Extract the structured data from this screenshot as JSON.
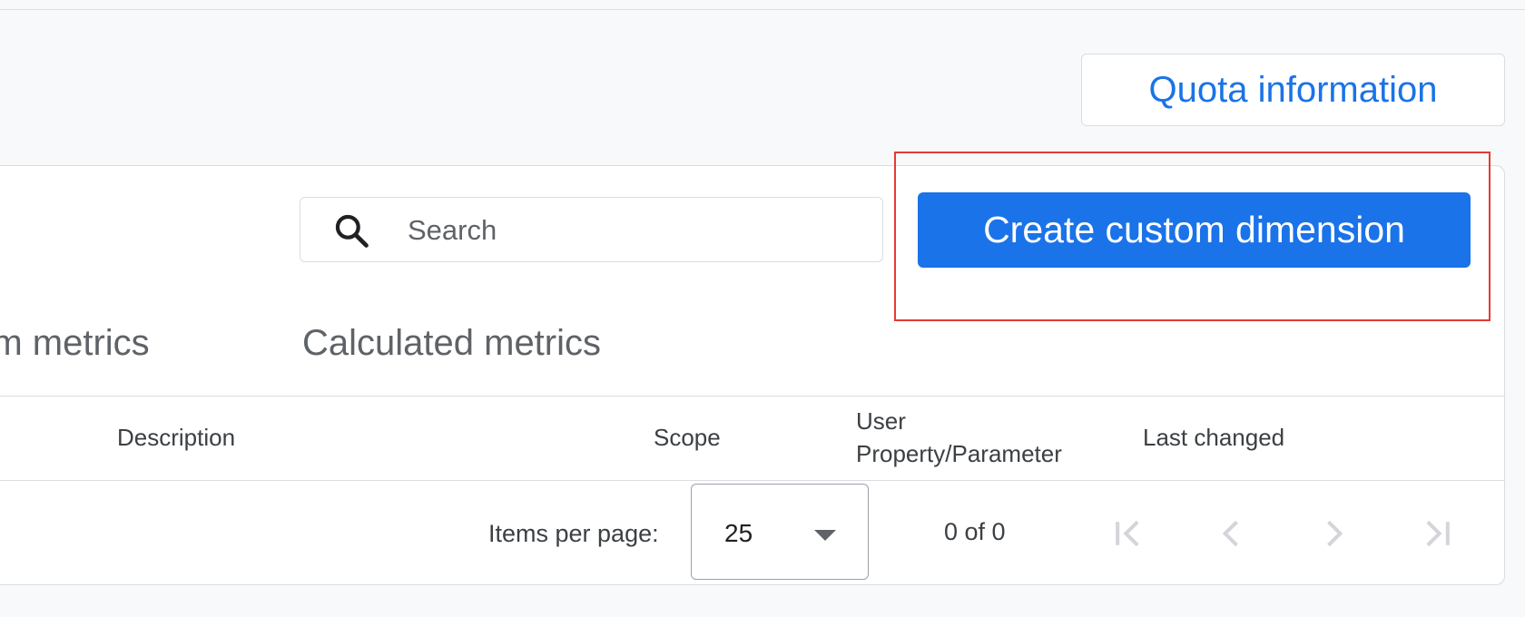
{
  "header": {
    "quota_button_label": "Quota information"
  },
  "toolbar": {
    "search_placeholder": "Search",
    "create_button_label": "Create custom dimension"
  },
  "tabs": [
    {
      "label": "stom metrics"
    },
    {
      "label": "Calculated metrics"
    }
  ],
  "table": {
    "columns": [
      {
        "label": "Description"
      },
      {
        "label": "Scope"
      },
      {
        "label_line1": "User",
        "label_line2": "Property/Parameter"
      },
      {
        "label": "Last changed"
      }
    ]
  },
  "pagination": {
    "items_per_page_label": "Items per page:",
    "page_size": "25",
    "range_label": "0 of 0"
  },
  "icons": {
    "search": "search-icon",
    "dropdown": "chevron-down-icon",
    "first_page": "first-page-icon",
    "prev_page": "chevron-left-icon",
    "next_page": "chevron-right-icon",
    "last_page": "last-page-icon"
  },
  "colors": {
    "accent": "#1a73e8",
    "highlight": "#e53935",
    "background": "#f8f9fa",
    "disabled_icon": "#d3d5d9"
  }
}
